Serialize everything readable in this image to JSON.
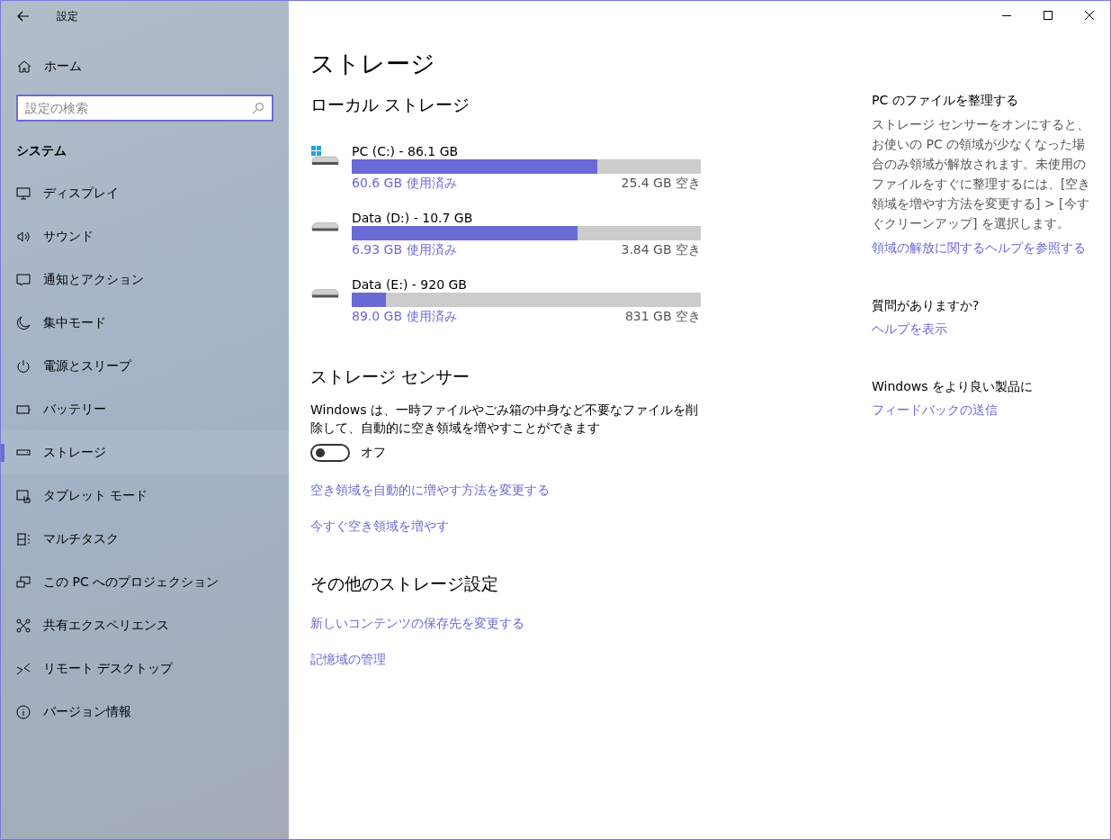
{
  "window": {
    "title": "設定"
  },
  "sidebar": {
    "home": "ホーム",
    "search": {
      "placeholder": "設定の検索"
    },
    "section": "システム",
    "items": [
      {
        "label": "ディスプレイ",
        "selected": false
      },
      {
        "label": "サウンド",
        "selected": false
      },
      {
        "label": "通知とアクション",
        "selected": false
      },
      {
        "label": "集中モード",
        "selected": false
      },
      {
        "label": "電源とスリープ",
        "selected": false
      },
      {
        "label": "バッテリー",
        "selected": false
      },
      {
        "label": "ストレージ",
        "selected": true
      },
      {
        "label": "タブレット モード",
        "selected": false
      },
      {
        "label": "マルチタスク",
        "selected": false
      },
      {
        "label": "この PC へのプロジェクション",
        "selected": false
      },
      {
        "label": "共有エクスペリエンス",
        "selected": false
      },
      {
        "label": "リモート デスクトップ",
        "selected": false
      },
      {
        "label": "バージョン情報",
        "selected": false
      }
    ]
  },
  "page": {
    "title": "ストレージ",
    "local_heading": "ローカル ストレージ",
    "drives": [
      {
        "kind": "system",
        "name": "PC (C:) - 86.1 GB",
        "level": 0.704,
        "used": "60.6 GB 使用済み",
        "free": "25.4 GB 空き"
      },
      {
        "kind": "data",
        "name": "Data (D:) - 10.7 GB",
        "level": 0.648,
        "used": "6.93 GB 使用済み",
        "free": "3.84 GB 空き"
      },
      {
        "kind": "data",
        "name": "Data (E:) - 920 GB",
        "level": 0.097,
        "used": "89.0 GB 使用済み",
        "free": "831 GB 空き"
      }
    ],
    "sense": {
      "heading": "ストレージ センサー",
      "description": "Windows は、一時ファイルやごみ箱の中身など不要なファイルを削除して、自動的に空き領域を増やすことができます",
      "toggle": {
        "on": false,
        "label": "オフ"
      },
      "links": [
        "空き領域を自動的に増やす方法を変更する",
        "今すぐ空き領域を増やす"
      ]
    },
    "other": {
      "heading": "その他のストレージ設定",
      "links": [
        "新しいコンテンツの保存先を変更する",
        "記憶域の管理"
      ]
    }
  },
  "aside": [
    {
      "heading": "PC のファイルを整理する",
      "text": "ストレージ センサーをオンにすると、お使いの PC の領域が少なくなった場合のみ領域が解放されます。未使用のファイルをすぐに整理するには、[空き領域を増やす方法を変更する] > [今すぐクリーンアップ] を選択します。",
      "link": "領域の解放に関するヘルプを参照する"
    },
    {
      "heading": "質問がありますか?",
      "link": "ヘルプを表示"
    },
    {
      "heading": "Windows をより良い製品に",
      "link": "フィードバックの送信"
    }
  ]
}
